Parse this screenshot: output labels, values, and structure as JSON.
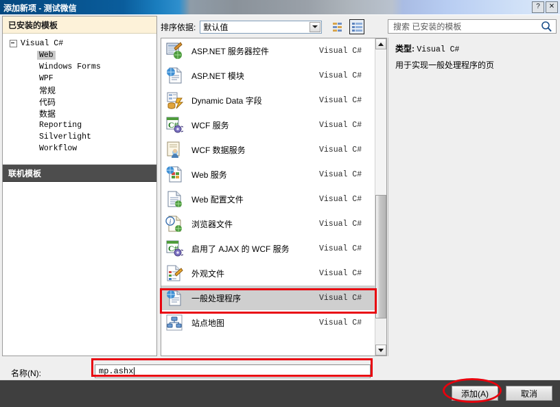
{
  "window": {
    "title": "添加新项 - 测试微信",
    "help_button": "?",
    "close_button": "✕"
  },
  "left_pane": {
    "installed_header": "已安装的模板",
    "online_header": "联机模板",
    "tree": {
      "root": "Visual C#",
      "children": [
        {
          "label": "Web",
          "selected": true
        },
        {
          "label": "Windows Forms",
          "selected": false
        },
        {
          "label": "WPF",
          "selected": false
        },
        {
          "label": "常规",
          "selected": false
        },
        {
          "label": "代码",
          "selected": false
        },
        {
          "label": "数据",
          "selected": false
        },
        {
          "label": "Reporting",
          "selected": false
        },
        {
          "label": "Silverlight",
          "selected": false
        },
        {
          "label": "Workflow",
          "selected": false
        }
      ]
    }
  },
  "toolbar": {
    "sort_label": "排序依据:",
    "sort_value": "默认值",
    "view_small_icons": "small-icons-view",
    "view_list": "list-view"
  },
  "search": {
    "placeholder": "搜索 已安装的模板",
    "icon": "search-icon"
  },
  "templates": [
    {
      "name": "ASP.NET 服务器控件",
      "language": "Visual C#",
      "selected": false
    },
    {
      "name": "ASP.NET 模块",
      "language": "Visual C#",
      "selected": false
    },
    {
      "name": "Dynamic Data 字段",
      "language": "Visual C#",
      "selected": false
    },
    {
      "name": "WCF 服务",
      "language": "Visual C#",
      "selected": false
    },
    {
      "name": "WCF 数据服务",
      "language": "Visual C#",
      "selected": false
    },
    {
      "name": "Web 服务",
      "language": "Visual C#",
      "selected": false
    },
    {
      "name": "Web 配置文件",
      "language": "Visual C#",
      "selected": false
    },
    {
      "name": "浏览器文件",
      "language": "Visual C#",
      "selected": false
    },
    {
      "name": "启用了 AJAX 的 WCF 服务",
      "language": "Visual C#",
      "selected": false
    },
    {
      "name": "外观文件",
      "language": "Visual C#",
      "selected": false
    },
    {
      "name": "一般处理程序",
      "language": "Visual C#",
      "selected": true
    },
    {
      "name": "站点地图",
      "language": "Visual C#",
      "selected": false
    }
  ],
  "info_pane": {
    "type_label": "类型:",
    "type_value": "Visual C#",
    "description": "用于实现一般处理程序的页"
  },
  "name_row": {
    "label": "名称(N):",
    "value": "mp.ashx"
  },
  "footer": {
    "add_label": "添加(A)",
    "cancel_label": "取消"
  },
  "colors": {
    "title_start": "#04487f",
    "installed_header_bg": "#fdf2d9",
    "online_header_bg": "#4d4d4d",
    "selection_bg": "#cfcfcf",
    "annotation_red": "#e8000d",
    "footer_bg": "#3f3f3f"
  }
}
